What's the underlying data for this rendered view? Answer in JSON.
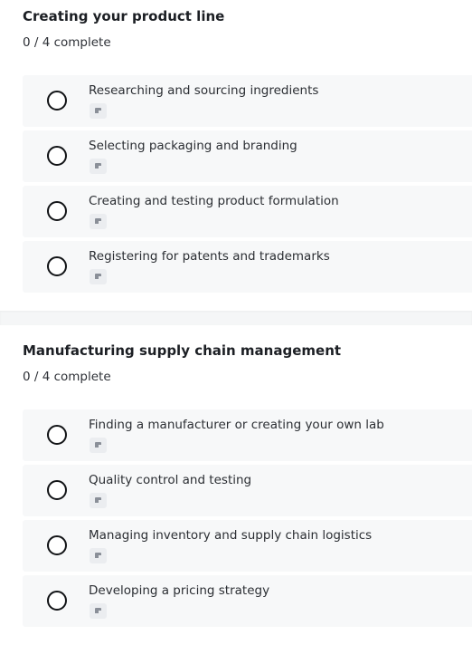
{
  "sections": [
    {
      "title": "Creating your product line",
      "progress": "0 / 4 complete",
      "tasks": [
        {
          "label": "Researching and sourcing ingredients",
          "completed": false,
          "icon": "note-icon"
        },
        {
          "label": "Selecting packaging and branding",
          "completed": false,
          "icon": "note-icon"
        },
        {
          "label": "Creating and testing product formulation",
          "completed": false,
          "icon": "note-icon"
        },
        {
          "label": "Registering for patents and trademarks",
          "completed": false,
          "icon": "note-icon"
        }
      ]
    },
    {
      "title": "Manufacturing supply chain management",
      "progress": "0 / 4 complete",
      "tasks": [
        {
          "label": "Finding a manufacturer or creating your own lab",
          "completed": false,
          "icon": "note-icon"
        },
        {
          "label": "Quality control and testing",
          "completed": false,
          "icon": "note-icon"
        },
        {
          "label": "Managing inventory and supply chain logistics",
          "completed": false,
          "icon": "note-icon"
        },
        {
          "label": "Developing a pricing strategy",
          "completed": false,
          "icon": "note-icon"
        }
      ]
    }
  ],
  "colors": {
    "task_background": "#f7f8f9",
    "checkbox_border": "#111316",
    "divider": "#f5f6f7"
  }
}
